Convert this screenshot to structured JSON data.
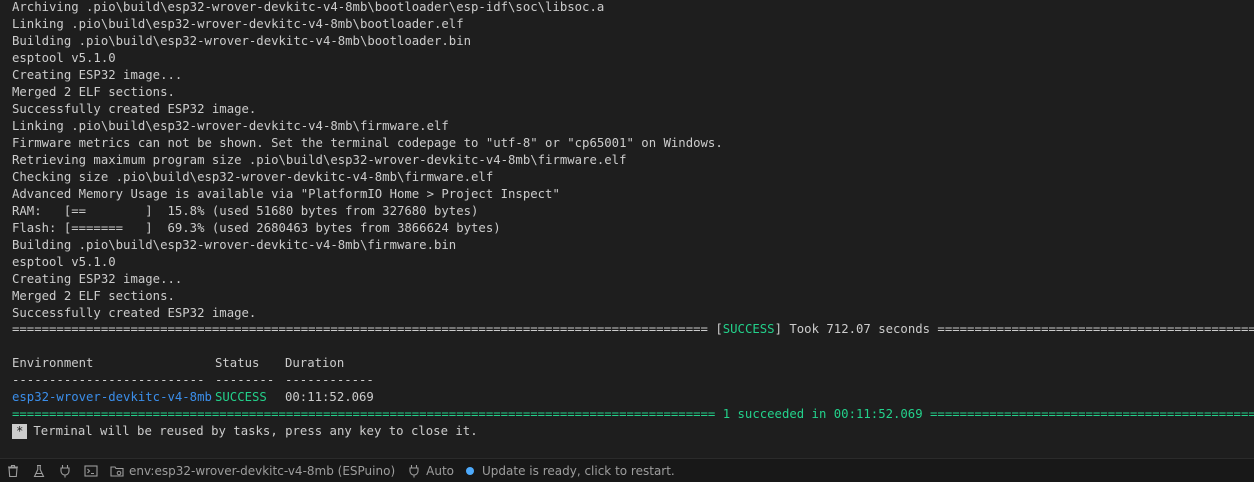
{
  "terminal": {
    "lines": [
      "Archiving .pio\\build\\esp32-wrover-devkitc-v4-8mb\\bootloader\\esp-idf\\soc\\libsoc.a",
      "Linking .pio\\build\\esp32-wrover-devkitc-v4-8mb\\bootloader.elf",
      "Building .pio\\build\\esp32-wrover-devkitc-v4-8mb\\bootloader.bin",
      "esptool v5.1.0",
      "Creating ESP32 image...",
      "Merged 2 ELF sections.",
      "Successfully created ESP32 image.",
      "Linking .pio\\build\\esp32-wrover-devkitc-v4-8mb\\firmware.elf",
      "Firmware metrics can not be shown. Set the terminal codepage to \"utf-8\" or \"cp65001\" on Windows.",
      "Retrieving maximum program size .pio\\build\\esp32-wrover-devkitc-v4-8mb\\firmware.elf",
      "Checking size .pio\\build\\esp32-wrover-devkitc-v4-8mb\\firmware.elf",
      "Advanced Memory Usage is available via \"PlatformIO Home > Project Inspect\"",
      "RAM:   [==        ]  15.8% (used 51680 bytes from 327680 bytes)",
      "Flash: [=======   ]  69.3% (used 2680463 bytes from 3866624 bytes)",
      "Building .pio\\build\\esp32-wrover-devkitc-v4-8mb\\firmware.bin",
      "esptool v5.1.0",
      "Creating ESP32 image...",
      "Merged 2 ELF sections.",
      "Successfully created ESP32 image."
    ],
    "summary_left": "============================================================================================== [",
    "summary_success": "SUCCESS",
    "summary_right": "] Took 712.07 seconds ================================================================",
    "table": {
      "headers": [
        "Environment",
        "Status",
        "Duration"
      ],
      "dashes": [
        "--------------------------",
        "--------",
        "------------"
      ],
      "row": [
        "esp32-wrover-devkitc-v4-8mb",
        "SUCCESS",
        "00:11:52.069"
      ]
    },
    "final_line": "=============================================================================================== 1 succeeded in 00:11:52.069 ============================================================================",
    "reuse_star": "*",
    "reuse_text": "Terminal will be reused by tasks, press any key to close it."
  },
  "statusbar": {
    "env_label": "env:esp32-wrover-devkitc-v4-8mb (ESPuino)",
    "auto_label": "Auto",
    "update_label": "Update is ready, click to restart."
  }
}
